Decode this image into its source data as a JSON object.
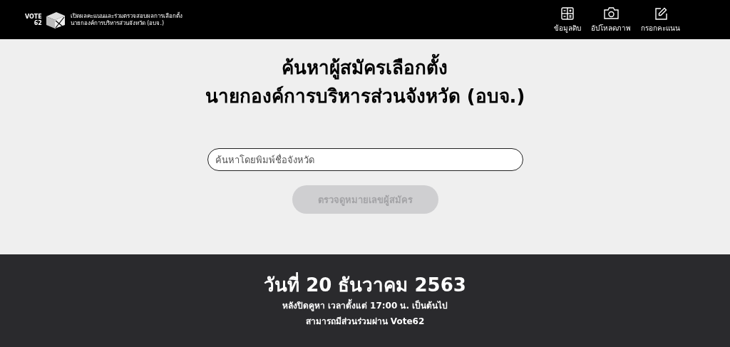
{
  "header": {
    "logo": {
      "line_1": "VOTE",
      "line_2": "62"
    },
    "tagline": [
      "เปิดผลคะแนนและร่วมตรวจสอบผลการเลือกตั้ง",
      "นายกองค์การบริหารส่วนจังหวัด (อบจ.)"
    ],
    "nav": [
      {
        "kind": "grid",
        "label": "ข้อมูลดิบ"
      },
      {
        "kind": "camera",
        "label": "อัปโหลดภาพ"
      },
      {
        "kind": "pencil",
        "label": "กรอกคะแนน"
      }
    ]
  },
  "main": {
    "title": [
      "ค้นหาผู้สมัครเลือกตั้ง",
      "นายกองค์การบริหารส่วนจังหวัด (อบจ.)"
    ],
    "search": {
      "placeholder": "ค้นหาโดยพิมพ์ชื่อจังหวัด"
    },
    "button": {
      "label": "ตรวจดูหมายเลขผู้สมัคร",
      "disabled": true
    }
  },
  "footer": {
    "date": "วันที่ 20 ธันวาคม 2563",
    "lines": [
      "หลังปิดคูหา เวลาตั้งแต่ 17:00 น. เป็นต้นไป",
      "สามารถมีส่วนร่วมผ่าน Vote62"
    ]
  }
}
